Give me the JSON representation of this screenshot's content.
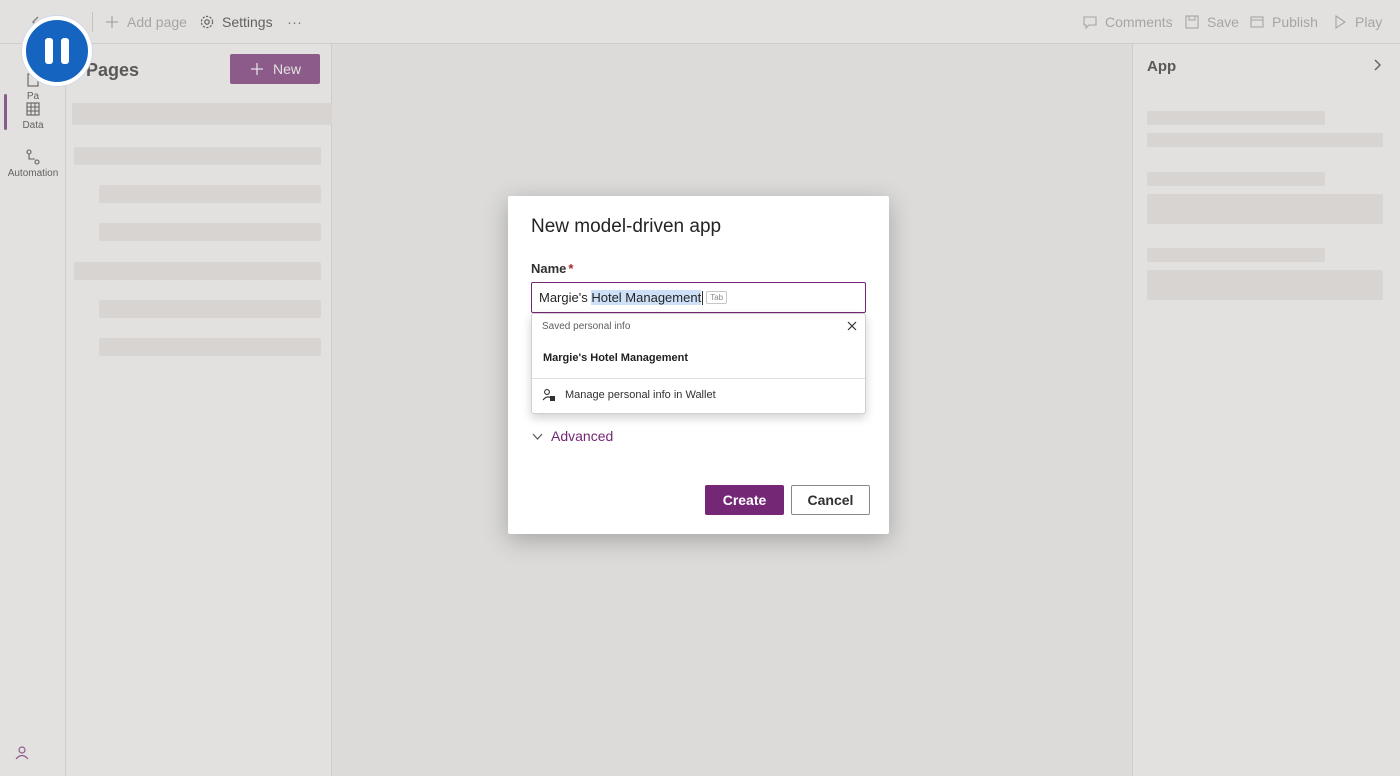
{
  "command_bar": {
    "add_page": "Add page",
    "settings": "Settings",
    "more": "···",
    "comments": "Comments",
    "save": "Save",
    "publish": "Publish",
    "play": "Play"
  },
  "rail": {
    "pages": "Pa",
    "data": "Data",
    "automation": "Automation"
  },
  "pages_panel": {
    "title": "Pages",
    "new_button": "New"
  },
  "right_panel": {
    "title": "App"
  },
  "dialog": {
    "title": "New model-driven app",
    "name_label": "Name",
    "required_marker": "*",
    "name_value_prefix": "Margie's ",
    "name_value_selected": "Hotel Management",
    "tab_hint": "Tab",
    "autofill": {
      "header": "Saved personal info",
      "suggestion": "Margie's Hotel Management",
      "manage_link": "Manage personal info in Wallet"
    },
    "advanced_label": "Advanced",
    "create_label": "Create",
    "cancel_label": "Cancel"
  },
  "colors": {
    "accent": "#742774",
    "pause_button": "#1565c0",
    "selection": "#cde0f7"
  }
}
